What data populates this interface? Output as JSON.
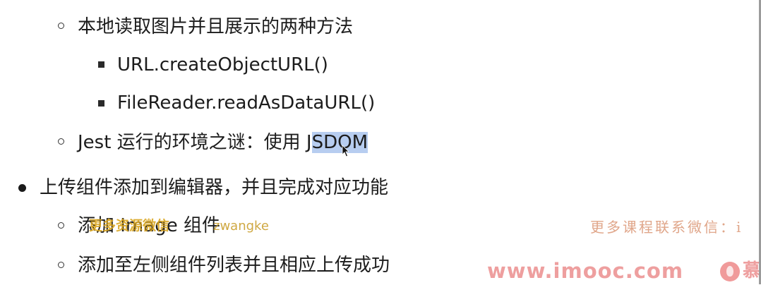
{
  "outline": {
    "item1": "本地读取图片并且展示的两种方法",
    "item1_sub1": "URL.createObjectURL()",
    "item1_sub2": "FileReader.readAsDataURL()",
    "item2_prefix": "Jest 运行的环境之谜：使用 J",
    "item2_selected": "SDOM",
    "bullet1": "上传组件添加到编辑器，并且完成对应功能",
    "bullet1_sub1": "添加 Image 组件",
    "bullet1_sub2": "添加至左侧组件列表并且相应上传成功"
  },
  "overlays": {
    "wechat_overlay": "更多资源微信",
    "wechat_id": "zwangke",
    "right_watermark": "更多课程联系微信：i",
    "site_url": "www.imooc.com",
    "brand_char": "慕"
  },
  "icons": {
    "hollow_bullet": "circle-bullet-icon",
    "square_bullet": "square-bullet-icon",
    "solid_bullet": "disc-bullet-icon",
    "cursor": "text-cursor-icon",
    "logo": "imooc-logo-icon"
  },
  "colors": {
    "selection": "#b7cdf0",
    "overlay_gold": "#d9a41c",
    "watermark_pink": "#ee9f9f"
  }
}
